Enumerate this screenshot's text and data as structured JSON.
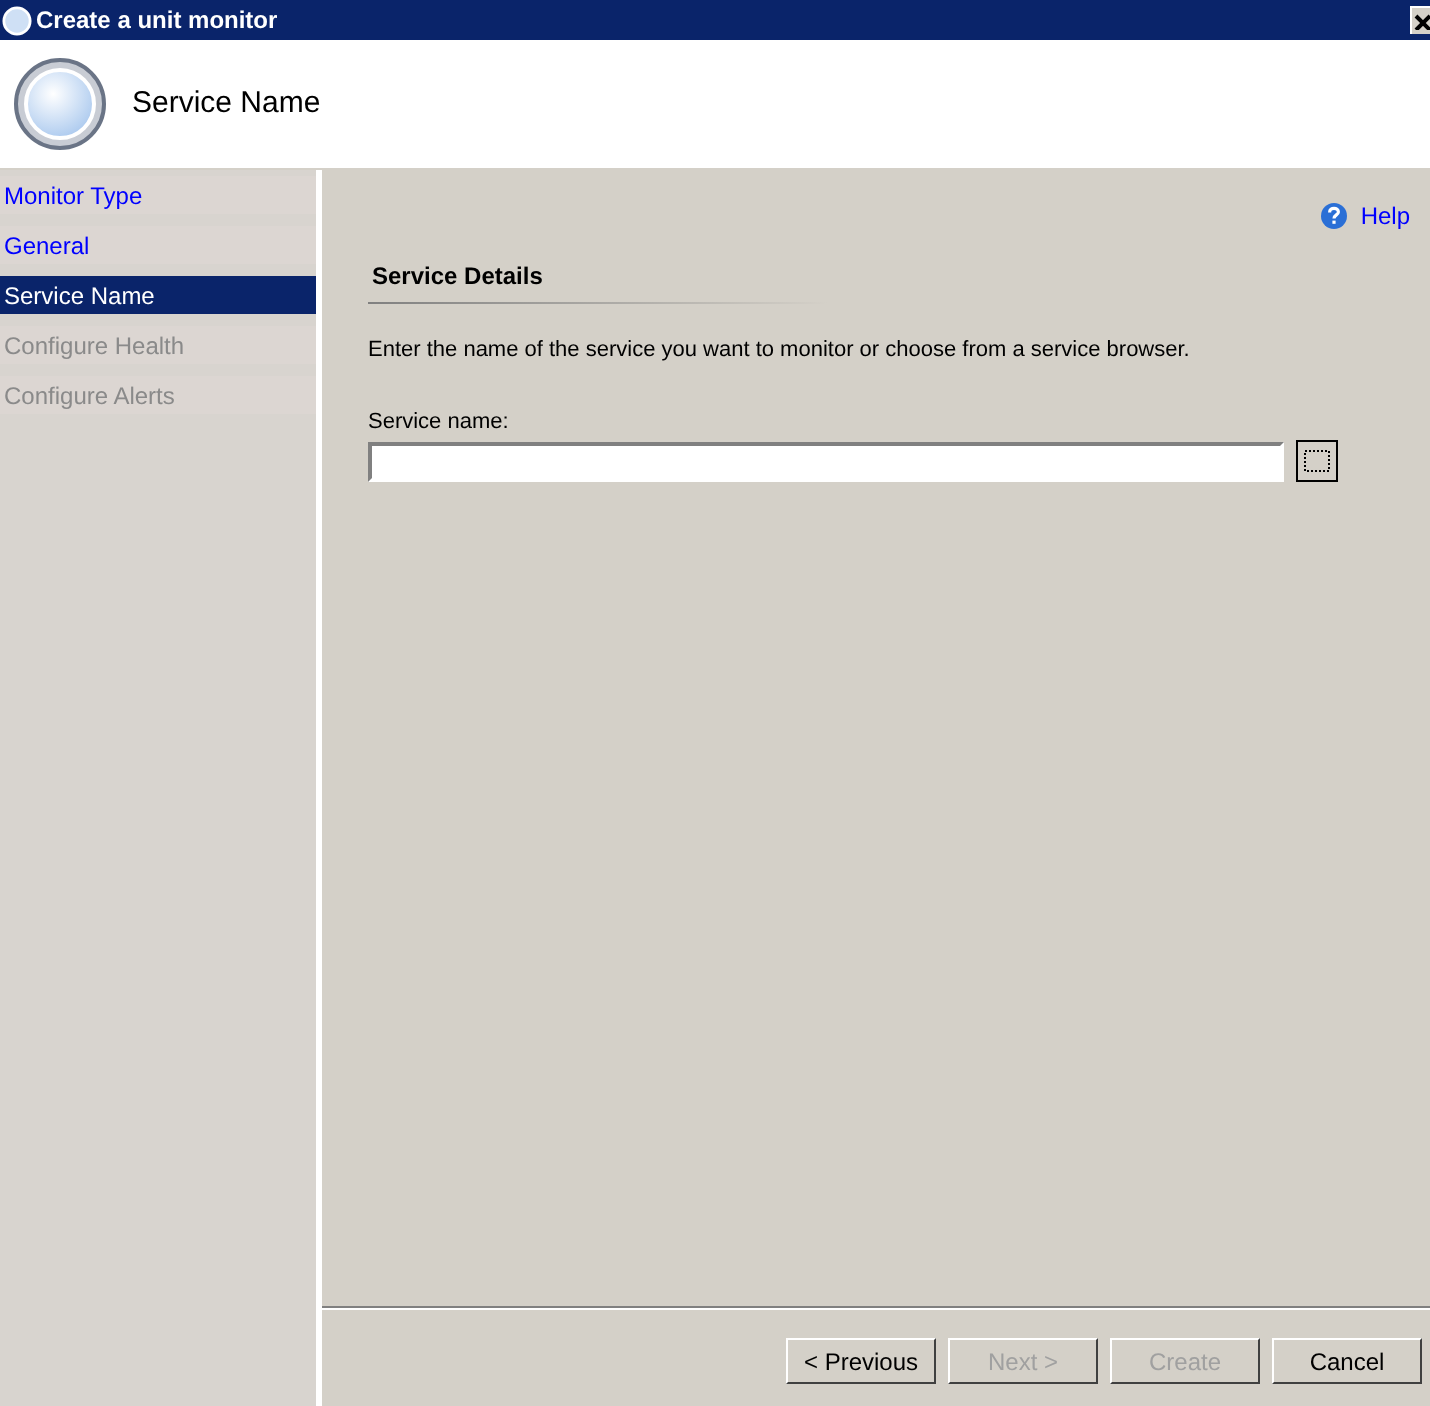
{
  "window": {
    "title": "Create a unit monitor"
  },
  "header": {
    "title": "Service Name"
  },
  "sidebar": {
    "items": [
      {
        "label": "Monitor Type",
        "selected": false,
        "disabled": false
      },
      {
        "label": "General",
        "selected": false,
        "disabled": false
      },
      {
        "label": "Service Name",
        "selected": true,
        "disabled": false
      },
      {
        "label": "Configure Health",
        "selected": false,
        "disabled": true
      },
      {
        "label": "Configure Alerts",
        "selected": false,
        "disabled": true
      }
    ]
  },
  "help": {
    "label": "Help"
  },
  "section": {
    "title": "Service Details",
    "description": "Enter the name of the service you want to monitor or choose from a service browser."
  },
  "service_field": {
    "label": "Service name:"
  },
  "buttons": [
    {
      "label": "< Previous",
      "disabled": false
    },
    {
      "label": "Next >",
      "disabled": true
    },
    {
      "label": "Create",
      "disabled": true
    },
    {
      "label": "Cancel",
      "disabled": false
    }
  ]
}
